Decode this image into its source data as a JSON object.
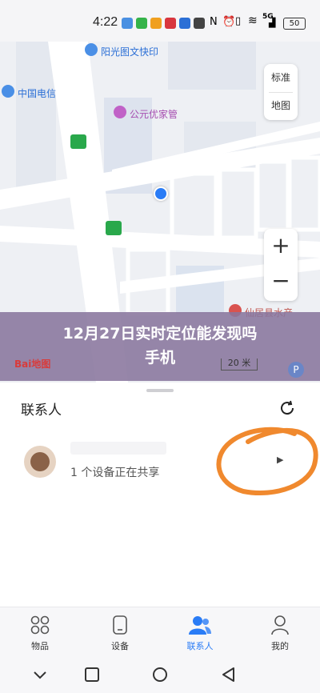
{
  "status_bar": {
    "time": "4:22",
    "network": "5G",
    "battery": "50"
  },
  "map": {
    "poi_1": "阳光图文快印",
    "poi_2": "中国电信",
    "poi_3": "公元优家管",
    "poi_4": "仙居县水产",
    "toggle_standard": "标准",
    "toggle_map": "地图",
    "zoom_in": "+",
    "zoom_out": "−",
    "scale": "20 米",
    "brand": "Bai地图",
    "colors": {
      "location_dot": "#2a7cf6",
      "poi_text": "#2b6fd6"
    }
  },
  "banner": {
    "title_line1": "12月27日实时定位能发现吗",
    "title_line2": "手机"
  },
  "contacts": {
    "heading": "联系人",
    "items": [
      {
        "status": "1 个设备正在共享"
      }
    ]
  },
  "tabs": [
    {
      "label": "物品",
      "icon": "grid-icon"
    },
    {
      "label": "设备",
      "icon": "device-icon"
    },
    {
      "label": "联系人",
      "icon": "contacts-icon",
      "active": true
    },
    {
      "label": "我的",
      "icon": "person-icon"
    }
  ],
  "accent_color": "#2a7cf6",
  "annotation_color": "#f0892e"
}
